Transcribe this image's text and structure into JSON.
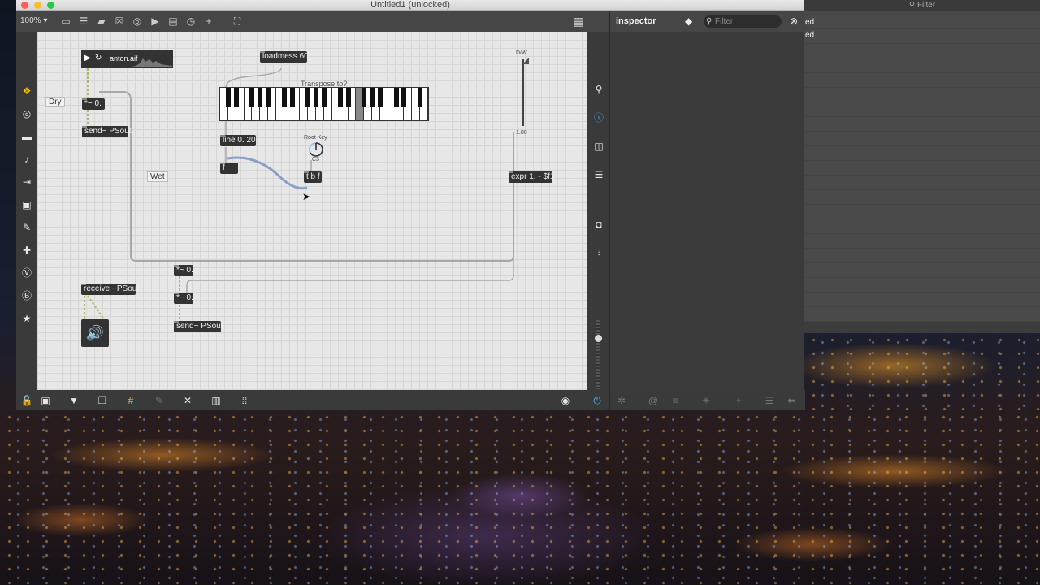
{
  "window": {
    "title": "Untitled1 (unlocked)",
    "zoom": "100%"
  },
  "right_panel": {
    "filter_label": "Filter",
    "row1": "ed",
    "row2": "ed"
  },
  "inspector": {
    "title": "inspector",
    "filter_placeholder": "Filter"
  },
  "patch": {
    "buffer_label": "anton.aif",
    "loadmess": "loadmess 60",
    "transpose_comment": "Transpose to?",
    "line": "line 0. 20",
    "f": "f",
    "root_key_label": "Root Key",
    "root_key_value": "C3",
    "tbf": "t b f",
    "dw_label": "D/W",
    "dw_value": "1.00",
    "expr": "expr 1. - $f1",
    "dry_comment": "Dry",
    "wet_comment": "Wet",
    "gain_top": "*~ 0.",
    "send_top": "send~ PSout",
    "gain_mid1": "*~ 0.",
    "gain_mid2": "*~ 0.",
    "send_bottom": "send~ PSout",
    "receive": "receive~ PSout"
  },
  "colors": {
    "canvas": "#e7e7e7",
    "object": "#333333",
    "wire_signal": "#8aa0c8",
    "wire_control": "#a0a0a0",
    "accent": "#3fa9f5"
  }
}
